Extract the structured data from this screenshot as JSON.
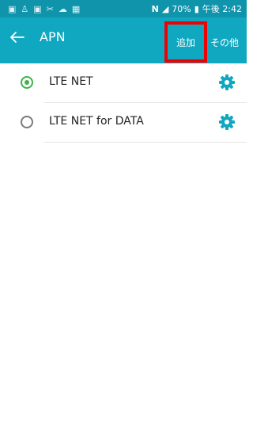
{
  "status_bar": {
    "notification_icons": [
      "image-icon",
      "person-icon",
      "image-icon",
      "tools-icon",
      "cloud-icon",
      "screenshot-icon"
    ],
    "network_label": "N",
    "battery": "70%",
    "time": "午後 2:42"
  },
  "app_bar": {
    "title": "APN",
    "add_label": "追加",
    "more_label": "その他"
  },
  "apn_items": [
    {
      "label": "LTE NET",
      "selected": true
    },
    {
      "label": "LTE NET for DATA",
      "selected": false
    }
  ],
  "colors": {
    "status_bar": "#0f94ab",
    "app_bar": "#10a7c0",
    "radio_checked": "#3fb14e",
    "gear": "#10a7c0",
    "highlight": "#f00000"
  }
}
